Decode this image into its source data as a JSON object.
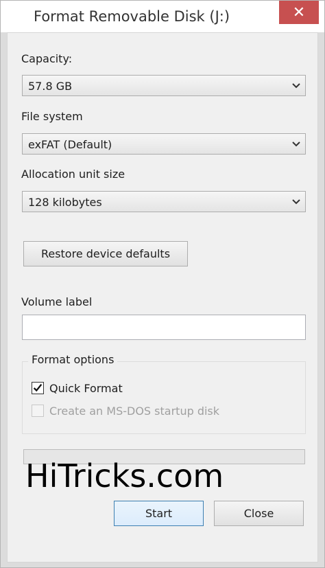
{
  "window": {
    "title": "Format Removable Disk (J:)",
    "close_glyph": "✕"
  },
  "capacity": {
    "label": "Capacity:",
    "value": "57.8 GB"
  },
  "file_system": {
    "label": "File system",
    "value": "exFAT (Default)"
  },
  "allocation": {
    "label": "Allocation unit size",
    "value": "128 kilobytes"
  },
  "restore_button": "Restore device defaults",
  "volume_label": {
    "label": "Volume label",
    "value": ""
  },
  "format_options": {
    "title": "Format options",
    "quick_format": {
      "label": "Quick Format",
      "checked": true
    },
    "msdos": {
      "label": "Create an MS-DOS startup disk",
      "checked": false,
      "disabled": true
    }
  },
  "progress": {
    "value": 0
  },
  "watermark": "HiTricks.com",
  "buttons": {
    "start": "Start",
    "close": "Close"
  },
  "icons": [
    "close-icon",
    "chevron-down-icon",
    "checkmark-icon"
  ],
  "colors": {
    "close_button": "#c75050",
    "default_button_border": "#3c7fb1"
  }
}
